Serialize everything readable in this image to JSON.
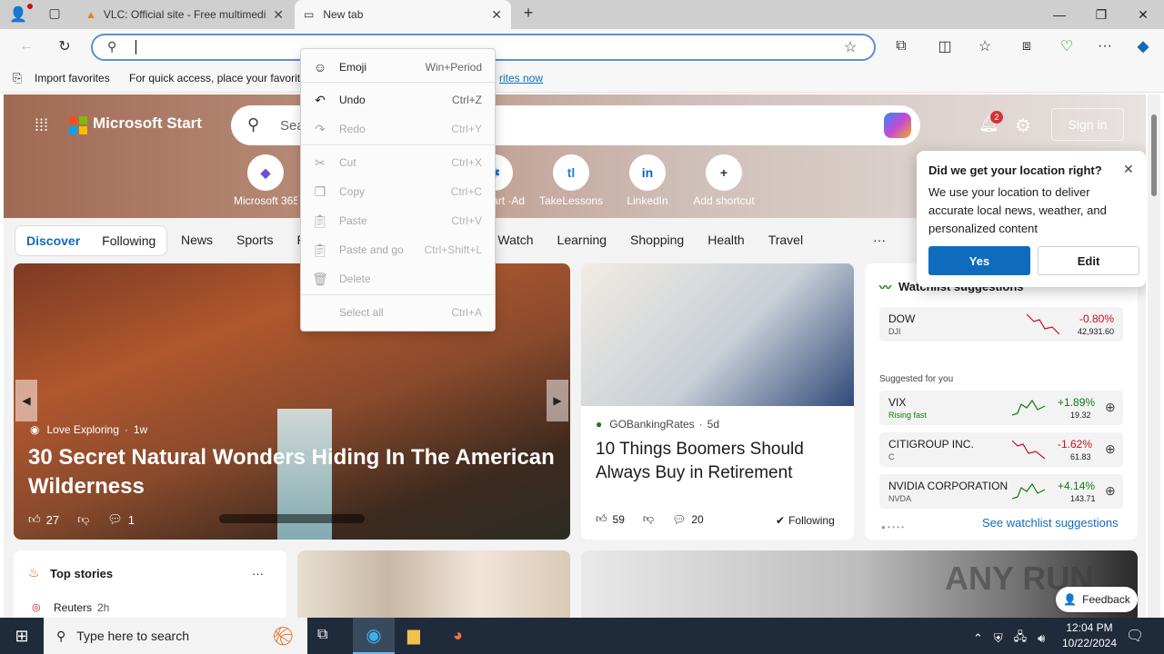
{
  "browser": {
    "tabs": [
      {
        "title": "VLC: Official site - Free multimedi"
      },
      {
        "title": "New tab"
      }
    ],
    "favorites_bar": {
      "import_label": "Import favorites",
      "hint": "For quick access, place your favorites",
      "link_fragment": "rites now"
    }
  },
  "context_menu": {
    "items": [
      {
        "label": "Emoji",
        "shortcut": "Win+Period"
      },
      {
        "label": "Undo",
        "shortcut": "Ctrl+Z"
      },
      {
        "label": "Redo",
        "shortcut": "Ctrl+Y"
      },
      {
        "label": "Cut",
        "shortcut": "Ctrl+X"
      },
      {
        "label": "Copy",
        "shortcut": "Ctrl+C"
      },
      {
        "label": "Paste",
        "shortcut": "Ctrl+V"
      },
      {
        "label": "Paste and go",
        "shortcut": "Ctrl+Shift+L"
      },
      {
        "label": "Delete",
        "shortcut": ""
      },
      {
        "label": "Select all",
        "shortcut": "Ctrl+A"
      }
    ]
  },
  "page": {
    "brand": "Microsoft Start",
    "search_placeholder": "Sea",
    "notification_count": "2",
    "sign_in": "Sign in",
    "quick_links": [
      {
        "label": "Microsoft 365",
        "glyph": "◆",
        "color": "#6b4fd8"
      },
      {
        "label": "y ·Ad",
        "glyph": "🛍",
        "color": "#333"
      },
      {
        "label": "Quickbo... ·Ad",
        "glyph": "qb",
        "color": "#2ca01c"
      },
      {
        "label": "Walmart ·Ad",
        "glyph": "✱",
        "color": "#0071ce"
      },
      {
        "label": "TakeLessons",
        "glyph": "tl",
        "color": "#2a7fd6"
      },
      {
        "label": "LinkedIn",
        "glyph": "in",
        "color": "#0a66c2"
      },
      {
        "label": "Add shortcut",
        "glyph": "+",
        "color": "#333"
      }
    ],
    "nav": {
      "discover": "Discover",
      "following": "Following",
      "items": [
        "News",
        "Sports",
        "Pl",
        "er",
        "Watch",
        "Learning",
        "Shopping",
        "Health",
        "Travel"
      ],
      "more": "···"
    },
    "hero_story": {
      "source": "Love Exploring",
      "age": "1w",
      "title": "30 Secret Natural Wonders Hiding In The American Wilderness",
      "likes": "27",
      "comments": "1"
    },
    "story2": {
      "source": "GOBankingRates",
      "age": "5d",
      "title": "10 Things Boomers Should Always Buy in Retirement",
      "likes": "59",
      "comments": "20",
      "following": "Following"
    },
    "watchlist": {
      "title": "Watchlist suggestions",
      "dow": {
        "name": "DOW",
        "sub": "DJI",
        "change": "-0.80%",
        "value": "42,931.60"
      },
      "suggested_label": "Suggested for you",
      "rows": [
        {
          "name": "VIX",
          "sub": "Rising fast",
          "change": "+1.89%",
          "value": "19.32",
          "up": true
        },
        {
          "name": "CITIGROUP INC.",
          "sub": "C",
          "change": "-1.62%",
          "value": "61.83",
          "up": false
        },
        {
          "name": "NVIDIA CORPORATION",
          "sub": "NVDA",
          "change": "+4.14%",
          "value": "143.71",
          "up": true
        }
      ],
      "see_link": "See watchlist suggestions"
    },
    "location_popup": {
      "title": "Did we get your location right?",
      "body": "We use your location to deliver accurate local news, weather, and personalized content",
      "yes": "Yes",
      "edit": "Edit"
    },
    "top_stories": {
      "title": "Top stories",
      "more": "···",
      "source": "Reuters",
      "age": "2h"
    },
    "feedback": "Feedback",
    "watermark": "ANY RUN"
  },
  "taskbar": {
    "search_placeholder": "Type here to search",
    "time": "12:04 PM",
    "date": "10/22/2024"
  },
  "colors": {
    "accent": "#0f6cbd",
    "green": "#107c10",
    "red": "#c50f1f",
    "taskbar": "#1f2b3a"
  }
}
